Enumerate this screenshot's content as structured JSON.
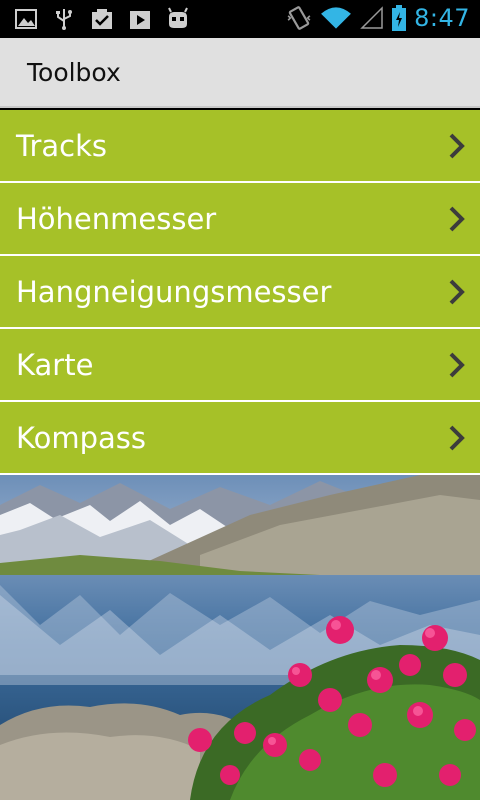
{
  "status_bar": {
    "time": "8:47",
    "left_icons": [
      "image-notification-icon",
      "usb-icon",
      "checkbox-download-icon",
      "play-store-icon",
      "cyanogenmod-icon"
    ],
    "right_icons": [
      "vibrate-icon",
      "wifi-icon",
      "signal-icon",
      "battery-charging-icon"
    ],
    "accent_color": "#33b5e5"
  },
  "action_bar": {
    "title": "Toolbox"
  },
  "menu": {
    "color": "#a6c128",
    "items": [
      {
        "label": "Tracks"
      },
      {
        "label": "Höhenmesser"
      },
      {
        "label": "Hangneigungsmesser"
      },
      {
        "label": "Karte"
      },
      {
        "label": "Kompass"
      }
    ]
  },
  "background_image": {
    "subject": "alpine-lake-with-pink-flowers"
  }
}
